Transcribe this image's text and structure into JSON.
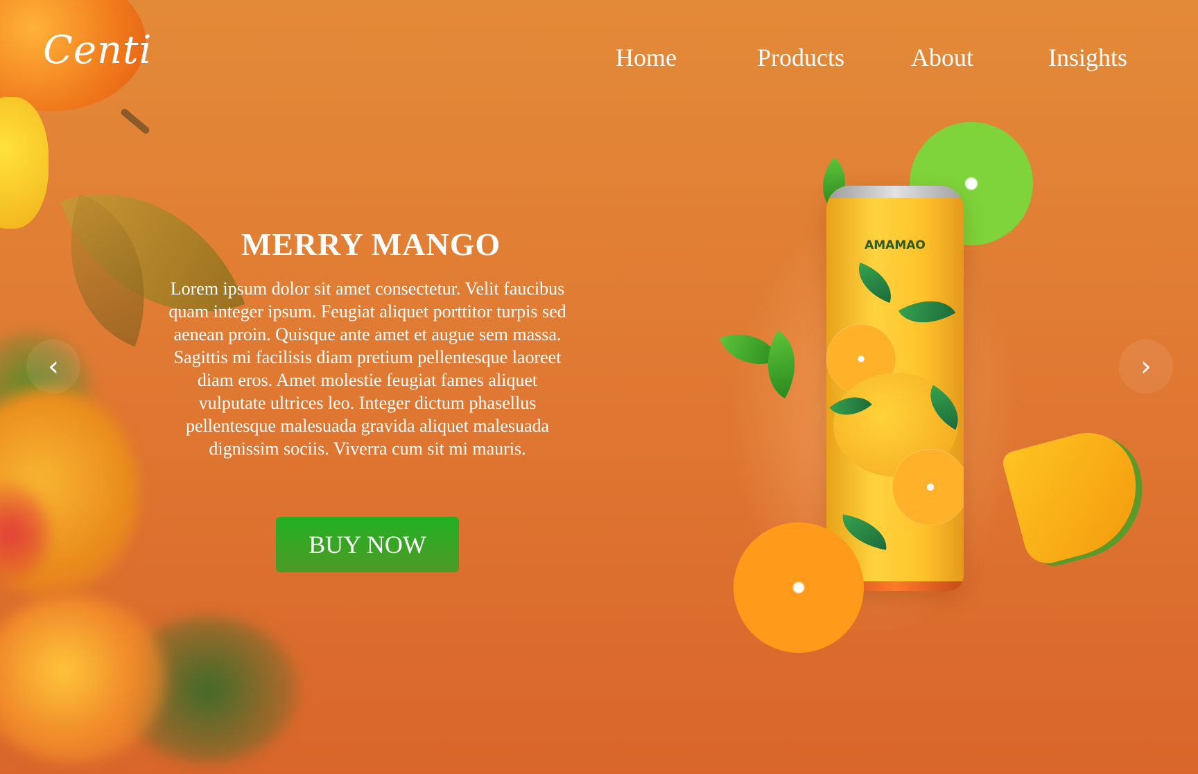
{
  "header": {
    "logo": "Centi",
    "nav": [
      "Home",
      "Products",
      "About",
      "Insights"
    ]
  },
  "hero": {
    "title": "MERRY MANGO",
    "body": "Lorem ipsum dolor sit amet consectetur. Velit faucibus quam integer ipsum. Feugiat aliquet porttitor turpis sed aenean proin. Quisque ante amet et augue sem massa. Sagittis mi facilisis diam pretium pellentesque laoreet diam eros. Amet molestie feugiat fames aliquet vulputate ultrices leo. Integer dictum phasellus pellentesque malesuada gravida aliquet malesuada dignissim sociis. Viverra cum sit mi mauris.",
    "cta": "BUY NOW"
  },
  "carousel": {
    "prev_icon": "‹",
    "next_icon": "›"
  },
  "product": {
    "can_label": "AMAMAO"
  },
  "colors": {
    "background": "#e07a33",
    "cta": "#2aa824",
    "text": "#ffffff"
  }
}
